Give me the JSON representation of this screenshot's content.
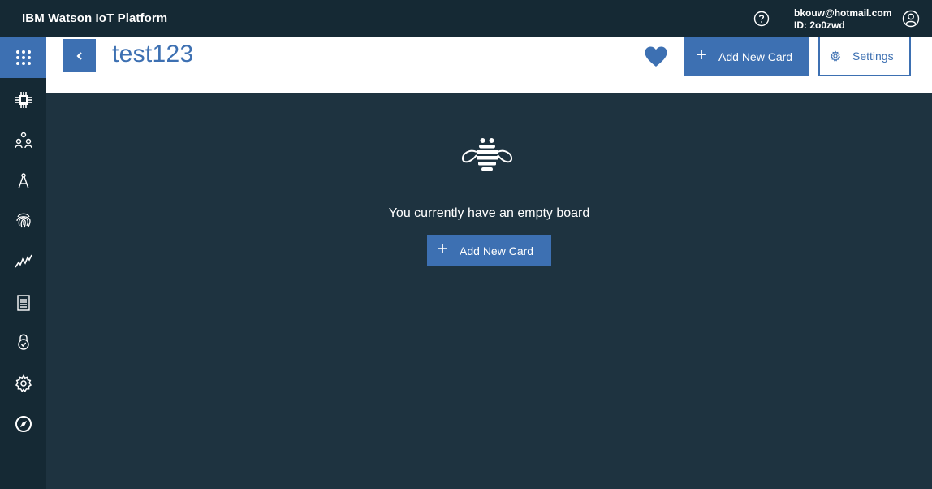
{
  "app": {
    "title": "IBM Watson IoT Platform"
  },
  "user": {
    "email": "bkouw@hotmail.com",
    "org_id": "ID: 2o0zwd"
  },
  "sidebar": {
    "items": [
      {
        "icon": "apps-grid-icon",
        "active": true
      },
      {
        "icon": "chip-icon"
      },
      {
        "icon": "members-icon"
      },
      {
        "icon": "compass-tool-icon"
      },
      {
        "icon": "fingerprint-icon"
      },
      {
        "icon": "analytics-icon"
      },
      {
        "icon": "document-icon"
      },
      {
        "icon": "lock-icon"
      },
      {
        "icon": "gear-icon"
      },
      {
        "icon": "explore-icon"
      }
    ]
  },
  "header": {
    "board_title": "test123",
    "add_card_label": "Add New Card",
    "settings_label": "Settings"
  },
  "empty_state": {
    "message": "You currently have an empty board",
    "add_card_label": "Add New Card"
  },
  "colors": {
    "accent": "#3d70b2",
    "nav_bg": "#152934",
    "page_bg": "#1e3340"
  }
}
